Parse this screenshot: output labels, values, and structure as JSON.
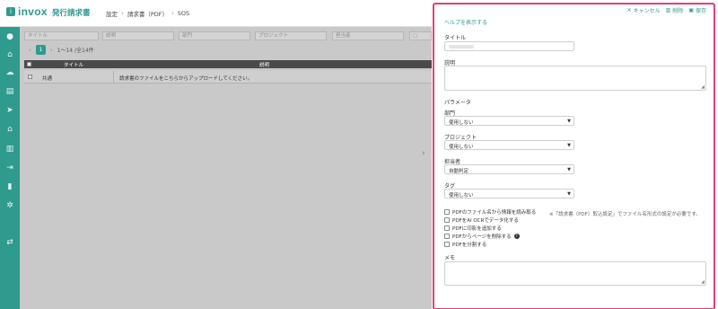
{
  "app": {
    "logo_text": "invox",
    "logo_sub": "発行請求書"
  },
  "breadcrumb": {
    "items": [
      "設定",
      "請求書（PDF）",
      "SOS"
    ]
  },
  "sidebar_icons": [
    "home-icon",
    "home-icon",
    "cloud-upload-icon",
    "document-icon",
    "send-icon",
    "bank-icon",
    "building-icon",
    "export-icon",
    "chart-icon",
    "gear-icon",
    "swap-icon"
  ],
  "filters": {
    "title_placeholder": "タイトル",
    "description_placeholder": "説明",
    "department_placeholder": "部門",
    "project_placeholder": "プロジェクト",
    "assignee_placeholder": "担当者"
  },
  "pager": {
    "current_page": "1",
    "range_text": "1〜14 /全14件"
  },
  "table": {
    "columns": [
      "タイトル",
      "説明"
    ],
    "rows": [
      {
        "title": "共通",
        "description": "請求書のファイルをこちらからアップロードしてください。"
      }
    ]
  },
  "panel": {
    "actions": {
      "cancel": "キャンセル",
      "delete": "削除",
      "save": "保存"
    },
    "help_link": "ヘルプを表示する",
    "title_label": "タイトル",
    "description_label": "説明",
    "parameters_label": "パラメータ",
    "department": {
      "label": "部門",
      "value": "使用しない"
    },
    "project": {
      "label": "プロジェクト",
      "value": "使用しない"
    },
    "assignee": {
      "label": "担当者",
      "value": "自動判定"
    },
    "tag": {
      "label": "タグ",
      "value": "使用しない"
    },
    "checkboxes": [
      "PDFのファイル名から情報を読み取る",
      "PDFをAI OCRでデータ化する",
      "PDFに印影を追加する",
      "PDFからページを削除する",
      "PDFを分割する"
    ],
    "filename_note": "※「請求書（PDF）取込設定」でファイル名形式の設定が必要です。",
    "memo_label": "メモ"
  },
  "colors": {
    "accent": "#2f9a8e",
    "panel_border": "#e0407b"
  }
}
